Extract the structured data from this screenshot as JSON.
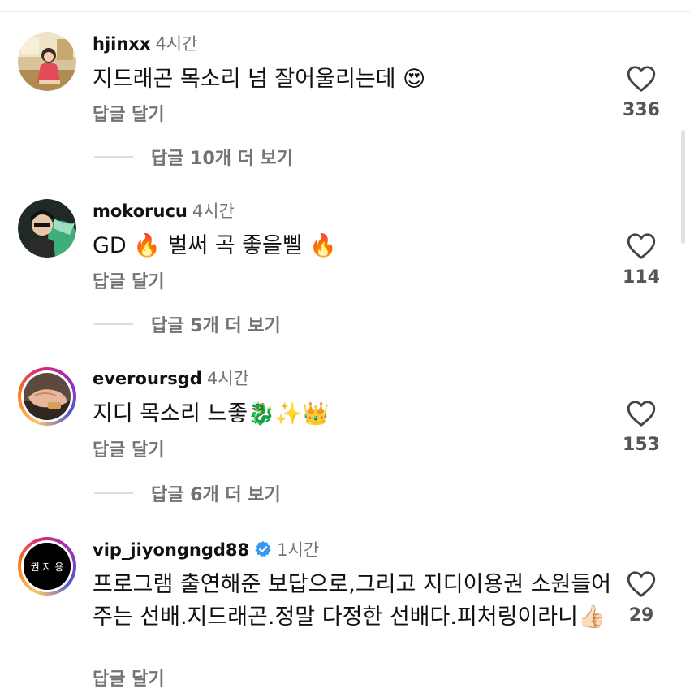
{
  "comments": [
    {
      "username": "hjinxx",
      "time": "4시간",
      "text": "지드래곤 목소리 넘 잘어울리는데 😍",
      "reply_label": "답글 달기",
      "view_replies": "답글 10개 더 보기",
      "likes": "336",
      "avatar_ring": false
    },
    {
      "username": "mokorucu",
      "time": "4시간",
      "text": "GD 🔥 벌써 곡 좋을삘 🔥",
      "reply_label": "답글 달기",
      "view_replies": "답글 5개 더 보기",
      "likes": "114",
      "avatar_ring": false
    },
    {
      "username": "everoursgd",
      "time": "4시간",
      "text": "지디 목소리 느좋🐉✨👑",
      "reply_label": "답글 달기",
      "view_replies": "답글 6개 더 보기",
      "likes": "153",
      "avatar_ring": true
    },
    {
      "username": "vip_jiyongngd88",
      "verified": true,
      "time": "1시간",
      "text": "프로그램 출연해준 보답으로,그리고 지디이용권 소원들어주는 선배.지드래곤.정말 다정한 선배다.피처링이라니👍🏻",
      "reply_label": "답글 달기",
      "likes": "29",
      "avatar_ring": true,
      "avatar_text": "권 지 용"
    }
  ],
  "colors": {
    "text": "#111111",
    "secondary": "#737373",
    "verified": "#3897f0"
  },
  "icons": {
    "like": "heart-outline-icon",
    "verified": "verified-badge-icon"
  }
}
